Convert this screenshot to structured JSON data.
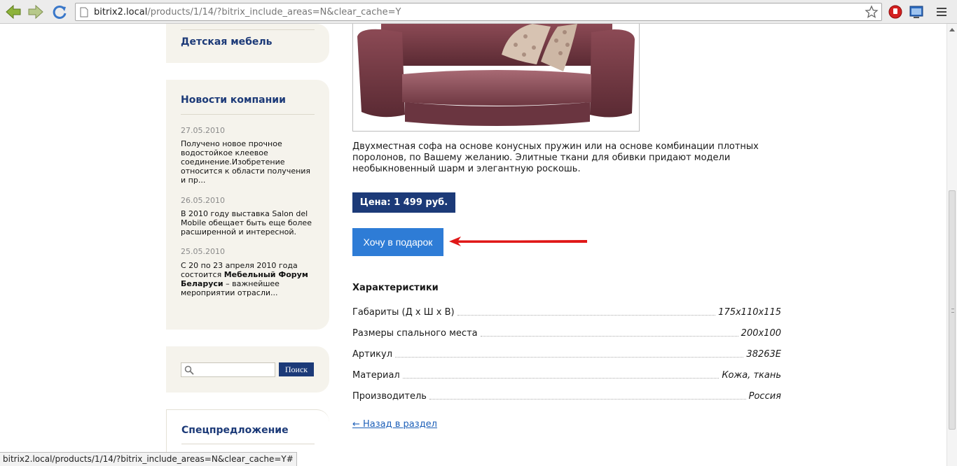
{
  "browser": {
    "url_host": "bitrix2.local",
    "url_path": "/products/1/14/?bitrix_include_areas=N&clear_cache=Y",
    "status_url": "bitrix2.local/products/1/14/?bitrix_include_areas=N&clear_cache=Y#"
  },
  "sidebar": {
    "kids_furniture": "Детская мебель",
    "news_title": "Новости компании",
    "news": [
      {
        "date": "27.05.2010",
        "text": "Получено новое прочное водостойкое клеевое соединение.Изобретение относится к области получения и пр..."
      },
      {
        "date": "26.05.2010",
        "text": "В 2010 году выставка Salon del Mobile обещает быть еще более расширенной и интересной."
      },
      {
        "date": "25.05.2010",
        "text_before": "С 20 по 23 апреля 2010 года состоится ",
        "text_bold": "Мебельный Форум Беларуси",
        "text_after": " – важнейшее мероприятии отрасли..."
      }
    ],
    "search": {
      "placeholder": "",
      "button": "Поиск"
    },
    "special_title": "Спецпредложение"
  },
  "product": {
    "description": "Двухместная софа на основе конусных пружин или на основе комбинации плотных поролонов, по Вашему желанию. Элитные ткани для обивки придают модели необыкновенный шарм и элегантную роскошь.",
    "price": "Цена: 1 499 руб.",
    "gift_button": "Хочу в подарок",
    "chars_title": "Характеристики",
    "chars": [
      {
        "label": "Габариты (Д х Ш х В)",
        "value": "175x110x115"
      },
      {
        "label": "Размеры спального места",
        "value": "200x100"
      },
      {
        "label": "Артикул",
        "value": "38263E"
      },
      {
        "label": "Материал",
        "value": "Кожа, ткань"
      },
      {
        "label": "Производитель",
        "value": "Россия"
      }
    ],
    "back_link": "← Назад в раздел"
  },
  "icons": [
    "back-arrow-icon",
    "forward-arrow-icon",
    "reload-icon",
    "page-icon",
    "star-icon",
    "stop-extension-icon",
    "window-extension-icon",
    "menu-icon",
    "search-icon",
    "red-arrow-annotation"
  ],
  "colors": {
    "brand_blue": "#1c3a78",
    "button_blue": "#2e7cd6",
    "sidebar_bg": "#f5f3ec",
    "annotation_red": "#e01818"
  }
}
